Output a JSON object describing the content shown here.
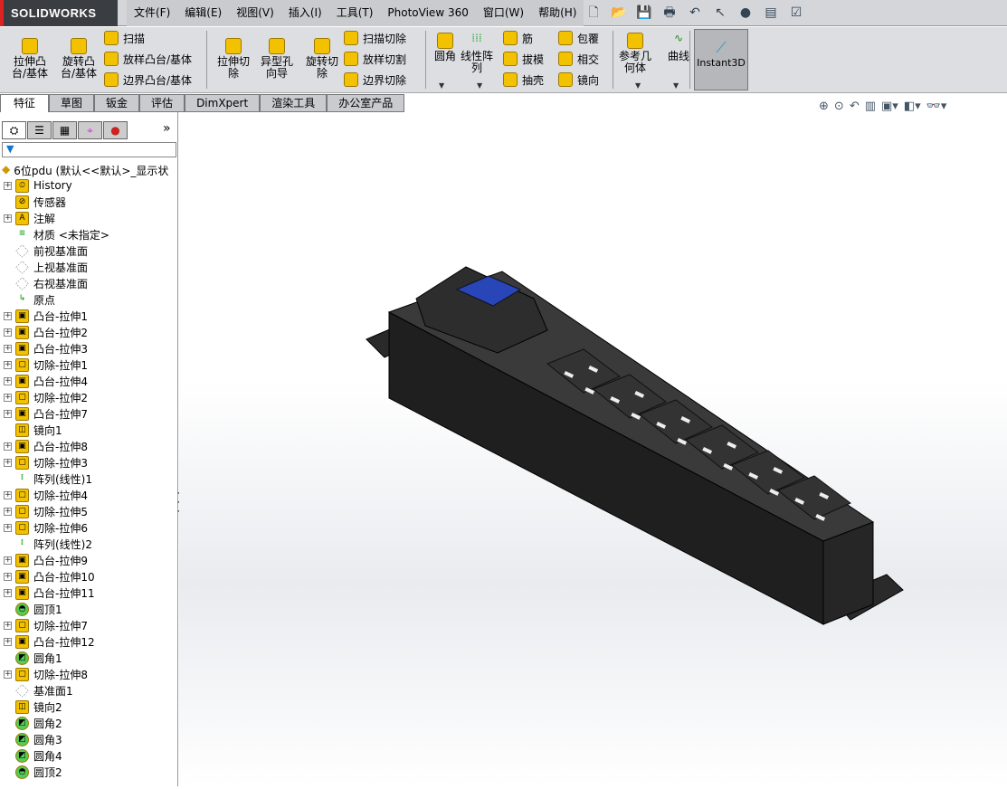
{
  "app": {
    "logo": "SOLIDWORKS"
  },
  "menu": [
    "文件(F)",
    "编辑(E)",
    "视图(V)",
    "插入(I)",
    "工具(T)",
    "PhotoView 360",
    "窗口(W)",
    "帮助(H)"
  ],
  "quick_access": [
    "new-icon",
    "open-icon",
    "save-icon",
    "print-icon",
    "undo-icon",
    "select-icon",
    "rebuild-icon",
    "file-properties-icon",
    "options-icon"
  ],
  "ribbon": {
    "big": [
      {
        "label": "拉伸凸\n台/基体"
      },
      {
        "label": "旋转凸\n台/基体"
      },
      {
        "label": "拉伸切\n除"
      },
      {
        "label": "异型孔\n向导"
      },
      {
        "label": "旋转切\n除"
      },
      {
        "label": "圆角"
      },
      {
        "label": "线性阵\n列"
      },
      {
        "label": "参考几\n何体"
      },
      {
        "label": "曲线"
      }
    ],
    "small1": [
      "扫描",
      "放样凸台/基体",
      "边界凸台/基体"
    ],
    "small2": [
      "扫描切除",
      "放样切割",
      "边界切除"
    ],
    "small3": [
      "筋",
      "拔模",
      "抽壳"
    ],
    "small4": [
      "包覆",
      "相交",
      "镜向"
    ],
    "instant3d": "Instant3D"
  },
  "tabs": [
    "特征",
    "草图",
    "钣金",
    "评估",
    "DimXpert",
    "渲染工具",
    "办公室产品"
  ],
  "panel": {
    "filter_icon": "filter-icon",
    "root": "6位pdu  (默认<<默认>_显示状",
    "more": "»"
  },
  "tree": [
    {
      "label": "History",
      "plus": true,
      "icon": "history"
    },
    {
      "label": "传感器",
      "plus": false,
      "icon": "sensor"
    },
    {
      "label": "注解",
      "plus": true,
      "icon": "annotation"
    },
    {
      "label": "材质 <未指定>",
      "plus": false,
      "icon": "material"
    },
    {
      "label": "前视基准面",
      "plus": false,
      "icon": "plane"
    },
    {
      "label": "上视基准面",
      "plus": false,
      "icon": "plane"
    },
    {
      "label": "右视基准面",
      "plus": false,
      "icon": "plane"
    },
    {
      "label": "原点",
      "plus": false,
      "icon": "origin"
    },
    {
      "label": "凸台-拉伸1",
      "plus": true,
      "icon": "extrude"
    },
    {
      "label": "凸台-拉伸2",
      "plus": true,
      "icon": "extrude"
    },
    {
      "label": "凸台-拉伸3",
      "plus": true,
      "icon": "extrude"
    },
    {
      "label": "切除-拉伸1",
      "plus": true,
      "icon": "cut"
    },
    {
      "label": "凸台-拉伸4",
      "plus": true,
      "icon": "extrude"
    },
    {
      "label": "切除-拉伸2",
      "plus": true,
      "icon": "cut"
    },
    {
      "label": "凸台-拉伸7",
      "plus": true,
      "icon": "extrude"
    },
    {
      "label": "镜向1",
      "plus": false,
      "icon": "mirror"
    },
    {
      "label": "凸台-拉伸8",
      "plus": true,
      "icon": "extrude"
    },
    {
      "label": "切除-拉伸3",
      "plus": true,
      "icon": "cut"
    },
    {
      "label": "阵列(线性)1",
      "plus": false,
      "icon": "pattern"
    },
    {
      "label": "切除-拉伸4",
      "plus": true,
      "icon": "cut"
    },
    {
      "label": "切除-拉伸5",
      "plus": true,
      "icon": "cut"
    },
    {
      "label": "切除-拉伸6",
      "plus": true,
      "icon": "cut"
    },
    {
      "label": "阵列(线性)2",
      "plus": false,
      "icon": "pattern"
    },
    {
      "label": "凸台-拉伸9",
      "plus": true,
      "icon": "extrude"
    },
    {
      "label": "凸台-拉伸10",
      "plus": true,
      "icon": "extrude"
    },
    {
      "label": "凸台-拉伸11",
      "plus": true,
      "icon": "extrude"
    },
    {
      "label": "圆顶1",
      "plus": false,
      "icon": "dome"
    },
    {
      "label": "切除-拉伸7",
      "plus": true,
      "icon": "cut"
    },
    {
      "label": "凸台-拉伸12",
      "plus": true,
      "icon": "extrude"
    },
    {
      "label": "圆角1",
      "plus": false,
      "icon": "fillet"
    },
    {
      "label": "切除-拉伸8",
      "plus": true,
      "icon": "cut"
    },
    {
      "label": "基准面1",
      "plus": false,
      "icon": "plane"
    },
    {
      "label": "镜向2",
      "plus": false,
      "icon": "mirror"
    },
    {
      "label": "圆角2",
      "plus": false,
      "icon": "fillet"
    },
    {
      "label": "圆角3",
      "plus": false,
      "icon": "fillet"
    },
    {
      "label": "圆角4",
      "plus": false,
      "icon": "fillet"
    },
    {
      "label": "圆顶2",
      "plus": false,
      "icon": "dome"
    }
  ],
  "view_toolbar": [
    "zoom-to-fit-icon",
    "zoom-area-icon",
    "previous-view-icon",
    "section-view-icon",
    "view-orientation-icon",
    "display-style-icon",
    "hide-show-icon"
  ],
  "colors": {
    "model": "#2b2b2b",
    "breaker": "#2846b8",
    "ribbon": "#dcdee2"
  }
}
